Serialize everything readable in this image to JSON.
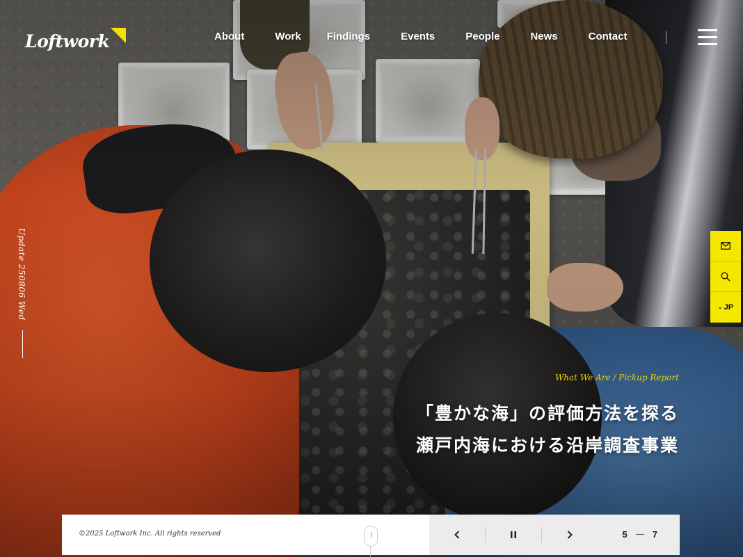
{
  "header": {
    "logo_text": "Loftwork",
    "nav": [
      {
        "label": "About"
      },
      {
        "label": "Work"
      },
      {
        "label": "Findings"
      },
      {
        "label": "Events"
      },
      {
        "label": "People"
      },
      {
        "label": "News"
      },
      {
        "label": "Contact"
      }
    ],
    "menu_icon": "hamburger-icon"
  },
  "update": {
    "text": "Update 250806 Wed"
  },
  "side_tools": {
    "mail_icon": "mail-icon",
    "search_icon": "search-icon",
    "lang_label": "JP"
  },
  "hero": {
    "label": "What We Are / Pickup Report",
    "title_line1": "「豊かな海」の評価方法を探る",
    "title_line2": "瀬戸内海における沿岸調査事業"
  },
  "footer_bar": {
    "copyright": "©2025 Loftwork Inc. All rights reserved",
    "prev_icon": "chevron-left-icon",
    "pause_icon": "pause-icon",
    "next_icon": "chevron-right-icon",
    "current_slide": "5",
    "total_slides": "7"
  },
  "colors": {
    "accent_yellow": "#f5e700",
    "label_yellow": "#e8d200",
    "bar_white": "#ffffff",
    "bar_gray": "#ececec"
  }
}
